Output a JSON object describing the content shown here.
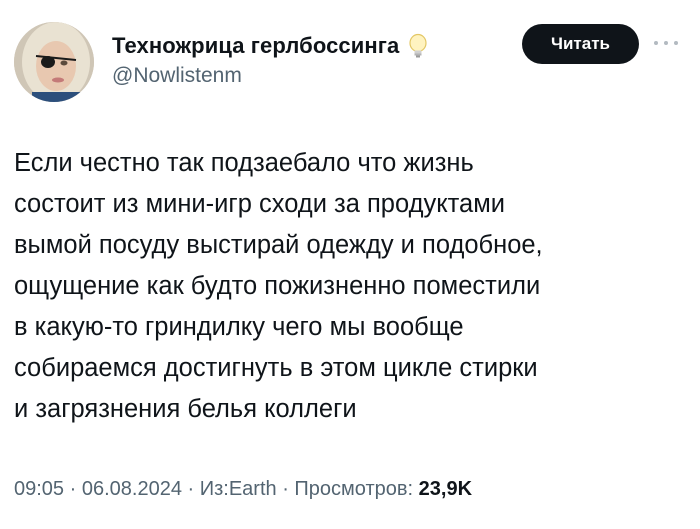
{
  "author": {
    "display_name": "Техножрица герлбоссинга",
    "handle": "@Nowlistenm",
    "badge_icon": "lightbulb-icon"
  },
  "actions": {
    "follow_label": "Читать",
    "more_icon": "more-dots-icon"
  },
  "tweet": {
    "text": "Если честно так подзаебало что жизнь\nсостоит из мини-игр сходи за продуктами\nвымой посуду выстирай одежду и подобное,\nощущение как будто пожизненно поместили\nв какую-то гриндилку чего мы вообще\nсобираемся достигнуть в этом цикле стирки\nи загрязнения белья коллеги"
  },
  "meta": {
    "time": "09:05",
    "separator": " · ",
    "date": "06.08.2024",
    "source": "Из:Earth",
    "views_label": "Просмотров:",
    "views_count": "23,9K"
  },
  "colors": {
    "text": "#0f1419",
    "muted": "#536471",
    "button_bg": "#0f1419",
    "button_text": "#ffffff"
  }
}
